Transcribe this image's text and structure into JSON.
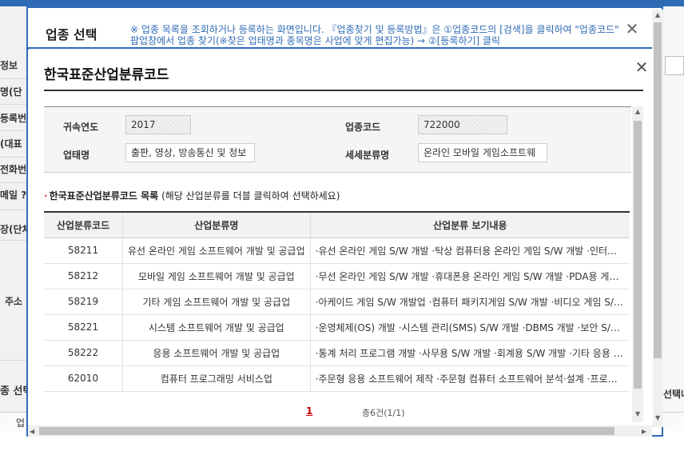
{
  "background": {
    "left_labels": [
      "정보",
      "명(단",
      "등록번",
      "(대표",
      "전화번",
      "메일 ?",
      "장(단체",
      "주소"
    ],
    "section_left": "종 선택",
    "right_label": "선택나",
    "bottom_label": "업"
  },
  "outer_modal": {
    "title": "업종 선택",
    "notice": "※ 업종 목록을 조회하거나 등록하는 화면입니다. 『업종찾기 및 등록방법』은 ①업종코드의 [검색]을 클릭하여 \"업종코드\" 팝업창에서 업종 찾기(※찾은 업태명과 종목명은 사업에 맞게 편집가능) → ②[등록하기] 클릭",
    "close_icon": "✕"
  },
  "inner_modal": {
    "title": "한국표준산업분류코드",
    "close_icon": "✕",
    "form": {
      "year_label": "귀속연도",
      "year_value": "2017",
      "industry_code_label": "업종코드",
      "industry_code_value": "722000",
      "business_type_label": "업태명",
      "business_type_value": "출판, 영상, 방송통신 및 정보",
      "sub_category_label": "세세분류명",
      "sub_category_value": "온라인 모바일 게임소프트웨"
    },
    "list_title_bold": "한국표준산업분류코드 목록",
    "list_title_hint": "(해당 산업분류를 더블 클릭하여 선택하세요)",
    "table": {
      "headers": [
        "산업분류코드",
        "산업분류명",
        "산업분류 보기내용"
      ],
      "rows": [
        {
          "code": "58211",
          "name": "유선 온라인 게임 소프트웨어 개발 및 공급업",
          "desc": "·유선 온라인 게임 S/W 개발 ·탁상 컴퓨터용 온라인 게임 S/W 개발 ·인터넷 게임 개발"
        },
        {
          "code": "58212",
          "name": "모바일 게임 소프트웨어 개발 및 공급업",
          "desc": "·무선 온라인 게임 S/W 개발 ·휴대폰용 온라인 게임 S/W 개발 ·PDA용 게임 개발"
        },
        {
          "code": "58219",
          "name": "기타 게임 소프트웨어 개발 및 공급업",
          "desc": "·아케이드 게임 S/W 개발업 ·컴퓨터 패키지게임 S/W 개발 ·비디오 게임 S/W 개발"
        },
        {
          "code": "58221",
          "name": "시스템 소프트웨어 개발 및 공급업",
          "desc": "·운영체제(OS) 개발 ·시스템 관리(SMS) S/W 개발 ·DBMS 개발 ·보안 S/W 개발"
        },
        {
          "code": "58222",
          "name": "응용 소프트웨어 개발 및 공급업",
          "desc": "·통계 처리 프로그램 개발 ·사무용 S/W 개발 ·회계용 S/W 개발 ·기타 응용 S/W"
        },
        {
          "code": "62010",
          "name": "컴퓨터 프로그래밍 서비스업",
          "desc": "·주문형 응용 소프트웨어 제작 ·주문형 컴퓨터 소프트웨어 분석·설계 ·프로그래밍"
        }
      ]
    },
    "pagination": {
      "current_page": "1",
      "summary": "총6건(1/1)"
    }
  }
}
